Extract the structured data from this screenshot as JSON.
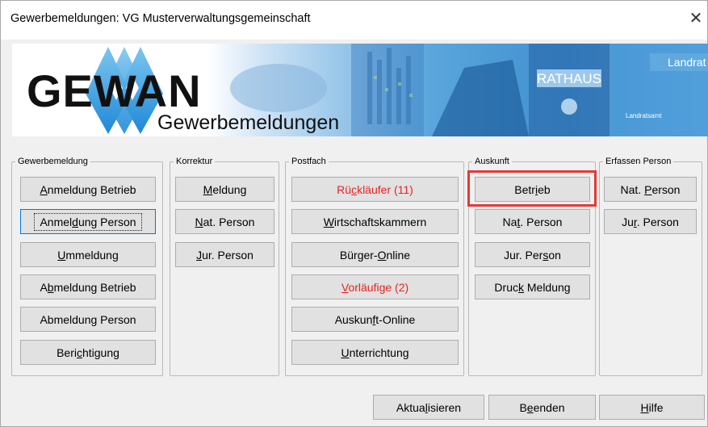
{
  "window": {
    "title": "Gewerbemeldungen: VG Musterverwaltungsgemeinschaft",
    "close_glyph": "✕"
  },
  "banner": {
    "logo_text": "GEWAN",
    "subtitle": "Gewerbemeldungen",
    "sign_rathaus": "RATHAUS",
    "sign_landrat": "Landrat",
    "sign_landratsamt": "Landratsamt"
  },
  "groups": {
    "gewerbemeldung": {
      "legend": "Gewerbemeldung",
      "buttons": [
        {
          "pre": "",
          "key": "A",
          "post": "nmeldung Betrieb"
        },
        {
          "pre": "Anmel",
          "key": "d",
          "post": "ung Person"
        },
        {
          "pre": "",
          "key": "U",
          "post": "mmeldung"
        },
        {
          "pre": "A",
          "key": "b",
          "post": "meldung Betrieb"
        },
        {
          "pre": "Abmeldun",
          "key": "g",
          "post": " Person"
        },
        {
          "pre": "Beri",
          "key": "c",
          "post": "htigung"
        }
      ]
    },
    "korrektur": {
      "legend": "Korrektur",
      "buttons": [
        {
          "pre": "",
          "key": "M",
          "post": "eldung"
        },
        {
          "pre": "",
          "key": "N",
          "post": "at. Person"
        },
        {
          "pre": "",
          "key": "J",
          "post": "ur. Person"
        }
      ]
    },
    "postfach": {
      "legend": "Postfach",
      "buttons": [
        {
          "pre": "Rü",
          "key": "c",
          "post": "kläufer (11)",
          "color": "#e8221f"
        },
        {
          "pre": "",
          "key": "W",
          "post": "irtschaftskammern"
        },
        {
          "pre": "Bürger-",
          "key": "O",
          "post": "nline"
        },
        {
          "pre": "",
          "key": "V",
          "post": "orläufige (2)",
          "color": "#e8221f"
        },
        {
          "pre": "Auskun",
          "key": "f",
          "post": "t-Online"
        },
        {
          "pre": "",
          "key": "U",
          "post": "nterrichtung"
        }
      ]
    },
    "auskunft": {
      "legend": "Auskunft",
      "buttons": [
        {
          "pre": "Betr",
          "key": "i",
          "post": "eb"
        },
        {
          "pre": "Na",
          "key": "t",
          "post": ". Person"
        },
        {
          "pre": "Jur. Per",
          "key": "s",
          "post": "on"
        },
        {
          "pre": "Druc",
          "key": "k",
          "post": " Meldung"
        }
      ]
    },
    "erfassen_person": {
      "legend": "Erfassen Person",
      "buttons": [
        {
          "pre": "Nat. ",
          "key": "P",
          "post": "erson"
        },
        {
          "pre": "Ju",
          "key": "r",
          "post": ". Person"
        }
      ]
    }
  },
  "footer": {
    "buttons": [
      {
        "pre": "Aktua",
        "key": "l",
        "post": "isieren"
      },
      {
        "pre": "B",
        "key": "e",
        "post": "enden"
      },
      {
        "pre": "",
        "key": "H",
        "post": "ilfe"
      }
    ]
  },
  "colors": {
    "highlight": "#e53935",
    "warning_text": "#e8221f",
    "logo_blue": "#2a8fd6"
  }
}
